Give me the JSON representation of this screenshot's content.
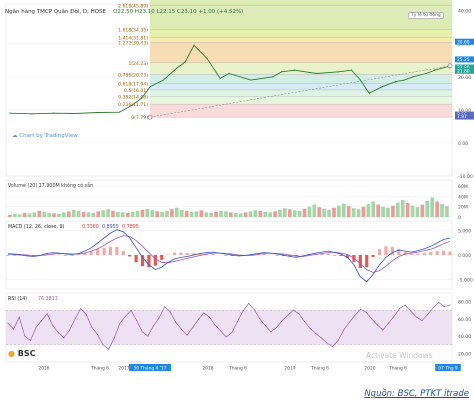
{
  "header": {
    "title": "Ngân hàng TMCP Quân Đội, D, HOSE",
    "values": "O22.50  H23.10  L22.15  C23.10  +1.00 (+4.52%)",
    "badge": "Tỷ lệ tự động"
  },
  "watermark": "Chart by TradingView",
  "logo": "BSC",
  "os_watermark": "Activate Windows",
  "source_note": "Nguồn: BSC, PTKT itrade",
  "colors": {
    "price": "#2e7d32",
    "grid": "#e6e6e6",
    "macd_line": "#3451c7",
    "signal_line": "#9b59b6",
    "hist_neg": "#e53935",
    "rsi_line": "#9b59b6",
    "rsi_band": "#efe1f4",
    "last_price_tag": "#1e88e5"
  },
  "chart_data": [
    {
      "type": "line",
      "name": "price",
      "x_labels": [
        "2016",
        "Tháng 6",
        "2017",
        "30 Tháng 4 '17",
        "2018",
        "Tháng 6",
        "2019",
        "Tháng 6",
        "2020",
        "Tháng 6",
        "07 Thg 9"
      ],
      "x": [
        0,
        0.05,
        0.1,
        0.15,
        0.2,
        0.25,
        0.28,
        0.3,
        0.32,
        0.35,
        0.38,
        0.4,
        0.42,
        0.45,
        0.48,
        0.5,
        0.55,
        0.6,
        0.62,
        0.65,
        0.7,
        0.75,
        0.78,
        0.8,
        0.82,
        0.85,
        0.88,
        0.9,
        0.92,
        0.95,
        0.97,
        1.0
      ],
      "y": [
        9.0,
        8.8,
        9.0,
        8.9,
        9.2,
        9.3,
        11.5,
        13.5,
        17.0,
        19.0,
        22.5,
        24.5,
        29.5,
        25.5,
        19.5,
        21.0,
        19.0,
        20.0,
        21.5,
        22.0,
        21.0,
        21.5,
        22.0,
        19.0,
        15.0,
        17.0,
        18.5,
        19.0,
        20.0,
        21.0,
        22.0,
        23.1
      ],
      "ylim": [
        -10,
        42
      ],
      "y_ticks": [
        40.0,
        30.0,
        20.0,
        10.0,
        0.0,
        -10.0
      ],
      "price_tags": [
        [
          "30.60",
          "25.25"
        ],
        [
          "22.80",
          "21.80"
        ],
        [
          "8.56",
          "7.97"
        ]
      ],
      "fib_levels": [
        {
          "label": "2.618(45.89)",
          "value": 45.89,
          "band": "#d7e8a8"
        },
        {
          "label": "1.618(34.35)",
          "value": 34.35,
          "band": "#e3ef9e"
        },
        {
          "label": "1.414(31.81)",
          "value": 31.81,
          "band": "#f6e7a1"
        },
        {
          "label": "1.272(30.43)",
          "value": 30.43,
          "band": "#f4d7a8"
        },
        {
          "label": "1(24.23)",
          "value": 24.23,
          "band": "#e6f0c2"
        },
        {
          "label": "0.786(20.73)",
          "value": 20.73,
          "band": "#c9ebe1"
        },
        {
          "label": "0.618(17.94)",
          "value": 17.94,
          "band": "#cfe8f6"
        },
        {
          "label": "0.5(16.01)",
          "value": 16.01,
          "band": "#d9f1e1"
        },
        {
          "label": "0.382(14.08)",
          "value": 14.08,
          "band": "#e2f4d9"
        },
        {
          "label": "0.236(11.71)",
          "value": 11.71,
          "band": "#f9d4d4"
        },
        {
          "label": "0(7.79)",
          "value": 7.79,
          "band": "#ffffff"
        }
      ]
    },
    {
      "type": "bar",
      "name": "Volume (20)",
      "legend": "Volume (20)   17.900M   không có sẵn",
      "y_ticks": [
        "60M",
        "40M",
        "20M",
        "0"
      ],
      "values": [
        4,
        6,
        5,
        8,
        7,
        9,
        12,
        10,
        8,
        7,
        6,
        9,
        11,
        14,
        12,
        10,
        9,
        8,
        11,
        13,
        15,
        12,
        10,
        9,
        8,
        10,
        12,
        14,
        16,
        13,
        11,
        10,
        12,
        15,
        18,
        14,
        12,
        10,
        11,
        13,
        9,
        8,
        10,
        12,
        11,
        9,
        8,
        7,
        9,
        11,
        13,
        12,
        10,
        9,
        11,
        14,
        17,
        15,
        13,
        12,
        16,
        20,
        24,
        19,
        16,
        14,
        18,
        22,
        26,
        21,
        17,
        15,
        20,
        25,
        30,
        24,
        20,
        18,
        22,
        28,
        33,
        27,
        22,
        19,
        24,
        31,
        38,
        30,
        25,
        21
      ]
    },
    {
      "type": "line",
      "name": "MACD (12, 26, close, 9)",
      "legend_values": [
        "0.3360",
        "0.8955",
        "0.7895"
      ],
      "y_ticks": [
        "5.000",
        "0.000",
        "-5.000"
      ],
      "macd": [
        0.2,
        0.1,
        0.0,
        -0.2,
        -0.3,
        -0.1,
        0.3,
        0.5,
        0.4,
        0.2,
        0.1,
        0.3,
        0.8,
        1.5,
        2.5,
        3.5,
        4.5,
        5.2,
        4.8,
        3.5,
        1.5,
        -0.5,
        -2.0,
        -3.0,
        -2.5,
        -1.5,
        -0.8,
        -0.5,
        -0.3,
        0.0,
        0.3,
        0.5,
        0.6,
        0.4,
        0.2,
        0.0,
        -0.2,
        -0.1,
        0.1,
        0.3,
        0.5,
        0.4,
        0.2,
        0.0,
        -0.3,
        -0.5,
        -0.2,
        0.1,
        0.4,
        0.6,
        0.8,
        0.5,
        0.2,
        -0.5,
        -2.0,
        -4.5,
        -5.5,
        -4.0,
        -2.0,
        -0.5,
        0.5,
        1.0,
        0.8,
        0.6,
        0.9,
        1.3,
        1.8,
        2.5,
        3.2,
        3.5
      ],
      "signal": [
        0.3,
        0.2,
        0.1,
        0.0,
        -0.1,
        -0.1,
        0.0,
        0.2,
        0.3,
        0.3,
        0.2,
        0.2,
        0.4,
        0.8,
        1.3,
        2.0,
        2.8,
        3.5,
        4.0,
        3.8,
        3.0,
        1.8,
        0.5,
        -0.8,
        -1.5,
        -1.6,
        -1.3,
        -1.0,
        -0.7,
        -0.4,
        -0.1,
        0.2,
        0.4,
        0.4,
        0.3,
        0.2,
        0.0,
        -0.1,
        -0.1,
        0.1,
        0.3,
        0.4,
        0.3,
        0.2,
        0.0,
        -0.2,
        -0.3,
        -0.1,
        0.1,
        0.3,
        0.5,
        0.6,
        0.4,
        0.1,
        -0.6,
        -1.8,
        -3.0,
        -3.6,
        -3.2,
        -2.3,
        -1.2,
        -0.3,
        0.2,
        0.4,
        0.6,
        0.9,
        1.2,
        1.7,
        2.3,
        2.8
      ]
    },
    {
      "type": "line",
      "name": "RSI (14)",
      "legend_values": [
        "76.3813"
      ],
      "y_ticks": [
        "80.00",
        "60.00",
        "40.00",
        "20.00"
      ],
      "band": [
        30,
        70
      ],
      "values": [
        55,
        48,
        62,
        40,
        35,
        50,
        58,
        66,
        52,
        44,
        38,
        47,
        60,
        72,
        65,
        50,
        42,
        30,
        25,
        38,
        55,
        63,
        70,
        58,
        45,
        40,
        52,
        61,
        74,
        68,
        56,
        48,
        41,
        50,
        59,
        67,
        62,
        53,
        46,
        39,
        44,
        57,
        69,
        78,
        71,
        60,
        52,
        45,
        50,
        58,
        64,
        70,
        66,
        57,
        49,
        43,
        38,
        32,
        28,
        35,
        47,
        56,
        64,
        71,
        68,
        60,
        53,
        47,
        55,
        63,
        72,
        76,
        69,
        62,
        58,
        65,
        73,
        79,
        74,
        76
      ]
    }
  ]
}
